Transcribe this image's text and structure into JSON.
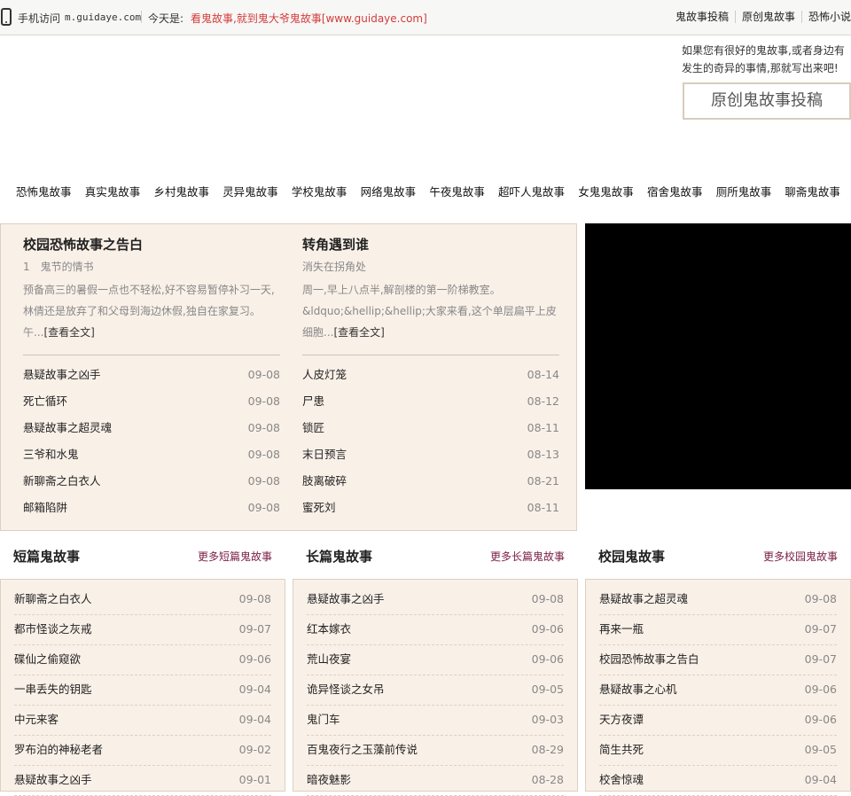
{
  "topbar": {
    "mobile_label": "手机访问",
    "mobile_url": "m.guidaye.com",
    "today_label": "今天是:",
    "today_text": "看鬼故事,就到鬼大爷鬼故事[www.guidaye.com]",
    "links": [
      "鬼故事投稿",
      "原创鬼故事",
      "恐怖小说"
    ]
  },
  "contribute": {
    "text": "如果您有很好的鬼故事,或者身边有发生的奇异的事情,那就写出来吧!",
    "button": "原创鬼故事投稿"
  },
  "nav": [
    "恐怖鬼故事",
    "真实鬼故事",
    "乡村鬼故事",
    "灵异鬼故事",
    "学校鬼故事",
    "网络鬼故事",
    "午夜鬼故事",
    "超吓人鬼故事",
    "女鬼鬼故事",
    "宿舍鬼故事",
    "厕所鬼故事",
    "聊斋鬼故事"
  ],
  "feature": {
    "left": {
      "title": "校园恐怖故事之告白",
      "subtitle": "1　鬼节的情书",
      "summary": "预备高三的暑假一点也不轻松,好不容易暂停补习一天,林倩还是放弃了和父母到海边休假,独自在家复习。午...",
      "more": "[查看全文]",
      "list": [
        {
          "title": "悬疑故事之凶手",
          "date": "09-08"
        },
        {
          "title": "死亡循环",
          "date": "09-08"
        },
        {
          "title": "悬疑故事之超灵魂",
          "date": "09-08"
        },
        {
          "title": "三爷和水鬼",
          "date": "09-08"
        },
        {
          "title": "新聊斋之白衣人",
          "date": "09-08"
        },
        {
          "title": "邮箱陷阱",
          "date": "09-08"
        }
      ]
    },
    "right": {
      "title": "转角遇到谁",
      "subtitle": "消失在拐角处",
      "summary": "周一,早上八点半,解剖楼的第一阶梯教室。&ldquo;&hellip;&hellip;大家来看,这个单层扁平上皮细胞...",
      "more": "[查看全文]",
      "list": [
        {
          "title": "人皮灯笼",
          "date": "08-14"
        },
        {
          "title": "尸患",
          "date": "08-12"
        },
        {
          "title": "锁匠",
          "date": "08-11"
        },
        {
          "title": "末日预言",
          "date": "08-13"
        },
        {
          "title": "肢离破碎",
          "date": "08-21"
        },
        {
          "title": "蜜死刘",
          "date": "08-11"
        }
      ]
    }
  },
  "sections": [
    {
      "title": "短篇鬼故事",
      "more": "更多短篇鬼故事",
      "items": [
        {
          "title": "新聊斋之白衣人",
          "date": "09-08"
        },
        {
          "title": "都市怪谈之灰戒",
          "date": "09-07"
        },
        {
          "title": "碟仙之偷窥欲",
          "date": "09-06"
        },
        {
          "title": "一串丢失的钥匙",
          "date": "09-04"
        },
        {
          "title": "中元来客",
          "date": "09-04"
        },
        {
          "title": "罗布泊的神秘老者",
          "date": "09-02"
        },
        {
          "title": "悬疑故事之凶手",
          "date": "09-01"
        }
      ]
    },
    {
      "title": "长篇鬼故事",
      "more": "更多长篇鬼故事",
      "items": [
        {
          "title": "悬疑故事之凶手",
          "date": "09-08"
        },
        {
          "title": "红本嫁衣",
          "date": "09-06"
        },
        {
          "title": "荒山夜宴",
          "date": "09-06"
        },
        {
          "title": "诡异怪谈之女吊",
          "date": "09-05"
        },
        {
          "title": "鬼门车",
          "date": "09-03"
        },
        {
          "title": "百鬼夜行之玉藻前传说",
          "date": "08-29"
        },
        {
          "title": "暗夜魅影",
          "date": "08-28"
        }
      ]
    },
    {
      "title": "校园鬼故事",
      "more": "更多校园鬼故事",
      "items": [
        {
          "title": "悬疑故事之超灵魂",
          "date": "09-08"
        },
        {
          "title": "再来一瓶",
          "date": "09-07"
        },
        {
          "title": "校园恐怖故事之告白",
          "date": "09-07"
        },
        {
          "title": "悬疑故事之心机",
          "date": "09-06"
        },
        {
          "title": "天方夜谭",
          "date": "09-06"
        },
        {
          "title": "简生共死",
          "date": "09-05"
        },
        {
          "title": "校舍惊魂",
          "date": "09-04"
        }
      ]
    }
  ]
}
